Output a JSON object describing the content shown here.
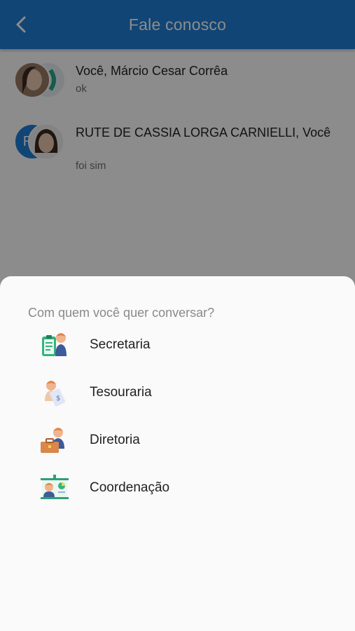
{
  "header": {
    "title": "Fale conosco",
    "back_icon": "chevron-left-icon"
  },
  "conversations": [
    {
      "name": "Você, Márcio Cesar Corrêa",
      "last_message": "ok"
    },
    {
      "name": "RUTE DE CASSIA LORGA CARNIELLI, Você",
      "last_message": "foi sim",
      "initial": "R"
    }
  ],
  "sheet": {
    "title": "Com quem você quer conversar?",
    "options": [
      {
        "label": "Secretaria",
        "icon": "clipboard-person-icon"
      },
      {
        "label": "Tesouraria",
        "icon": "money-person-icon"
      },
      {
        "label": "Diretoria",
        "icon": "briefcase-person-icon"
      },
      {
        "label": "Coordenação",
        "icon": "presentation-person-icon"
      }
    ]
  },
  "colors": {
    "appbar": "#1f7fd6",
    "avatar_blue": "#1f7fd6",
    "overlay": "rgba(0,0,0,0.45)"
  }
}
